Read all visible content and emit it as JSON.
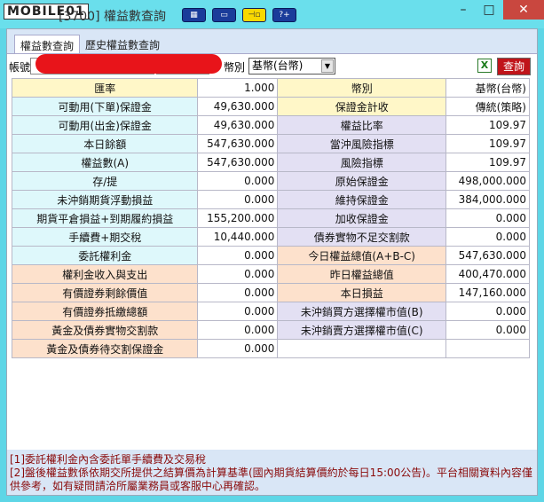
{
  "window": {
    "logo": "MOBILE01",
    "title": "[3700] 權益數查詢",
    "toolbar_icons": [
      "layout-icon",
      "window-icon",
      "pin-icon",
      "help-icon"
    ],
    "minimize": "–",
    "maximize": "□",
    "close": "✕"
  },
  "tabs": [
    {
      "label": "權益數查詢",
      "active": true
    },
    {
      "label": "歷史權益數查詢",
      "active": false
    }
  ],
  "form": {
    "account_label": "帳號",
    "currency_label": "幣別",
    "currency_value": "基幣(台幣)",
    "excel_label": "X",
    "query_label": "查詢"
  },
  "rows": [
    {
      "l1": "匯率",
      "v1": "1.000",
      "l2": "幣別",
      "v2": "基幣(台幣)",
      "c1": "Y",
      "c2": "Y"
    },
    {
      "l1": "可動用(下單)保證金",
      "v1": "49,630.000",
      "l2": "保證金計收",
      "v2": "傳統(策略)",
      "c1": "C",
      "c2": "Y"
    },
    {
      "l1": "可動用(出金)保證金",
      "v1": "49,630.000",
      "l2": "權益比率",
      "v2": "109.97",
      "c1": "C",
      "c2": "L"
    },
    {
      "l1": "本日餘額",
      "v1": "547,630.000",
      "l2": "當沖風險指標",
      "v2": "109.97",
      "c1": "C",
      "c2": "L"
    },
    {
      "l1": "權益數(A)",
      "v1": "547,630.000",
      "l2": "風險指標",
      "v2": "109.97",
      "c1": "C",
      "c2": "L"
    },
    {
      "l1": "存/提",
      "v1": "0.000",
      "l2": "原始保證金",
      "v2": "498,000.000",
      "c1": "C",
      "c2": "L"
    },
    {
      "l1": "未沖銷期貨浮動損益",
      "v1": "0.000",
      "l2": "維持保證金",
      "v2": "384,000.000",
      "c1": "C",
      "c2": "L"
    },
    {
      "l1": "期貨平倉損益+到期履約損益",
      "v1": "155,200.000",
      "l2": "加收保證金",
      "v2": "0.000",
      "c1": "C",
      "c2": "L"
    },
    {
      "l1": "手續費+期交稅",
      "v1": "10,440.000",
      "l2": "債券實物不足交割款",
      "v2": "0.000",
      "c1": "C",
      "c2": "L"
    },
    {
      "l1": "委託權利金",
      "v1": "0.000",
      "l2": "今日權益總值(A+B-C)",
      "v2": "547,630.000",
      "c1": "C",
      "c2": "P"
    },
    {
      "l1": "權利金收入與支出",
      "v1": "0.000",
      "l2": "昨日權益總值",
      "v2": "400,470.000",
      "c1": "P",
      "c2": "P"
    },
    {
      "l1": "有價證券剩餘價值",
      "v1": "0.000",
      "l2": "本日損益",
      "v2": "147,160.000",
      "c1": "P",
      "c2": "P"
    },
    {
      "l1": "有價證券抵繳總額",
      "v1": "0.000",
      "l2": "未沖銷買方選擇權市值(B)",
      "v2": "0.000",
      "c1": "P",
      "c2": "L"
    },
    {
      "l1": "黃金及債券實物交割款",
      "v1": "0.000",
      "l2": "未沖銷賣方選擇權市值(C)",
      "v2": "0.000",
      "c1": "P",
      "c2": "L"
    },
    {
      "l1": "黃金及債券待交割保證金",
      "v1": "0.000",
      "l2": "",
      "v2": "",
      "c1": "P",
      "c2": "W"
    }
  ],
  "notes": [
    "[1]委託權利金內含委託單手續費及交易稅",
    "[2]盤後權益數係依期交所提供之結算價為計算基準(國內期貨結算價約於每日15:00公告)。平台相關資料內容僅供參考，如有疑問請洽所屬業務員或客服中心再確認。"
  ]
}
